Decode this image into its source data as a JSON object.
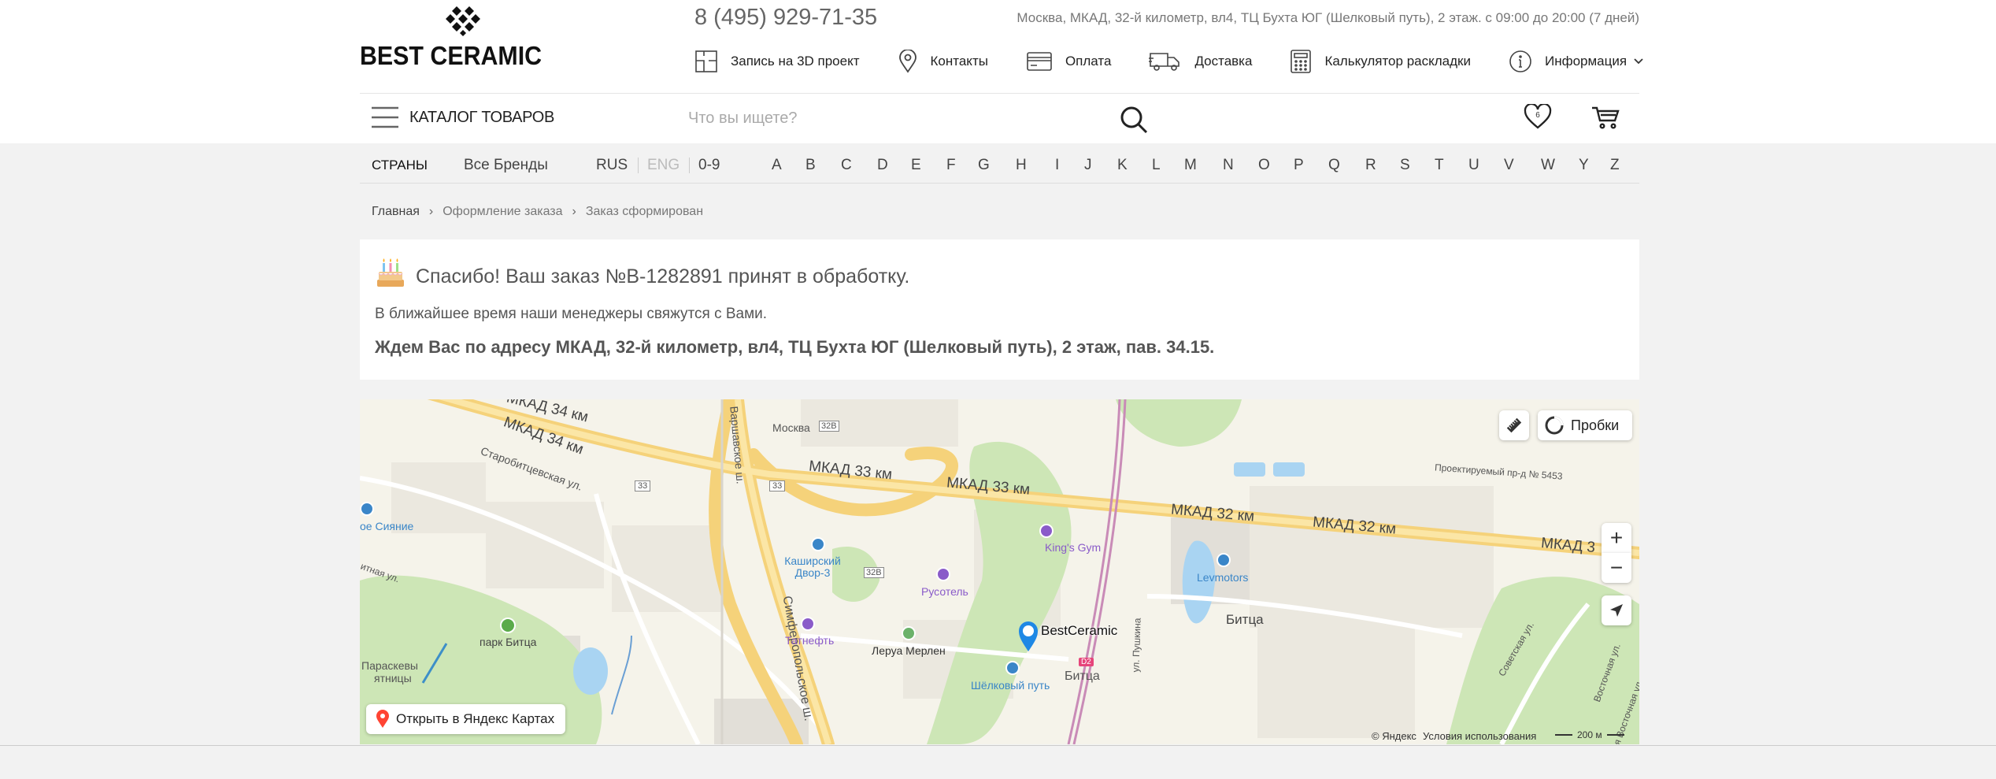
{
  "header": {
    "logo_text": "BEST CERAMIC",
    "phone": "8 (495) 929-71-35",
    "address": "Москва, МКАД, 32-й километр, вл4, ТЦ Бухта ЮГ (Шелковый путь), 2 этаж. с 09:00 до 20:00 (7 дней)",
    "nav": [
      {
        "label": "Запись на 3D проект",
        "icon": "3d-layout-icon"
      },
      {
        "label": "Контакты",
        "icon": "location-pin-icon"
      },
      {
        "label": "Оплата",
        "icon": "credit-card-icon"
      },
      {
        "label": "Доставка",
        "icon": "delivery-truck-icon"
      },
      {
        "label": "Калькулятор раскладки",
        "icon": "calculator-icon"
      },
      {
        "label": "Информация",
        "icon": "info-icon"
      }
    ]
  },
  "catalog_label": "КАТАЛОГ ТОВАРОВ",
  "search": {
    "placeholder": "Что вы ищете?"
  },
  "favorites_count": "6",
  "brands": {
    "countries": "СТРАНЫ",
    "all": "Все Бренды",
    "rus": "RUS",
    "eng": "ENG",
    "numbers": "0-9",
    "letters": [
      "A",
      "B",
      "C",
      "D",
      "E",
      "F",
      "G",
      "H",
      "I",
      "J",
      "K",
      "L",
      "M",
      "N",
      "O",
      "P",
      "Q",
      "R",
      "S",
      "T",
      "U",
      "V",
      "W",
      "Y",
      "Z"
    ]
  },
  "breadcrumb": [
    "Главная",
    "Оформление заказа",
    "Заказ сформирован"
  ],
  "order": {
    "title": "Спасибо! Ваш заказ №B-1282891 принят в обработку.",
    "subtitle": "В ближайшее время наши менеджеры свяжутся с Вами.",
    "address": "Ждем Вас по адресу МКАД, 32-й километр, вл4, ТЦ Бухта ЮГ (Шелковый путь), 2 этаж, пав. 34.15."
  },
  "map": {
    "traffic_label": "Пробки",
    "open_label": "Открыть в Яндекс Картах",
    "copyright": "© Яндекс",
    "terms": "Условия использования",
    "scale": "200 м",
    "marker_label": "BestCeramic",
    "labels": {
      "mkad34": "МКАД 34 км",
      "mkad34b": "МКАД 34 км",
      "mkad33": "МКАД 33 км",
      "mkad33b": "МКАД 33 км",
      "mkad32": "МКАД 32 км",
      "mkad32b": "МКАД 32 км",
      "mkad3x": "МКАД 3",
      "moskva": "Москва",
      "r32b1": "32В",
      "r32b2": "32В",
      "r33a": "33",
      "r33b": "33",
      "varsh": "Варшавское ш.",
      "simf": "Симферопольское ш.",
      "starob": "Старобитцевская ул.",
      "proekt": "Проектируемый пр-д № 5453",
      "siyanie": "ое Сияние",
      "kashir": "Каширский Двор-3",
      "rusotel": "Русотель",
      "kingsgym": "King's Gym",
      "levmotors": "Levmotors",
      "bitsa": "Битца",
      "bitsa_st": "Битца",
      "tatneft": "Татнефть",
      "leroy": "Леруа Мерлен",
      "shelk": "Шёлковый путь",
      "park": "парк Битца",
      "paraskevy": "Параскевы",
      "pyatnitsy": "ятницы",
      "pushkina": "ул. Пушкина",
      "sovetsk": "Советская ул.",
      "vostoch": "Восточная ул.",
      "vostoch2": "2-я Восточная ул.",
      "bitn": "итная ул.",
      "d2": "D2"
    }
  }
}
